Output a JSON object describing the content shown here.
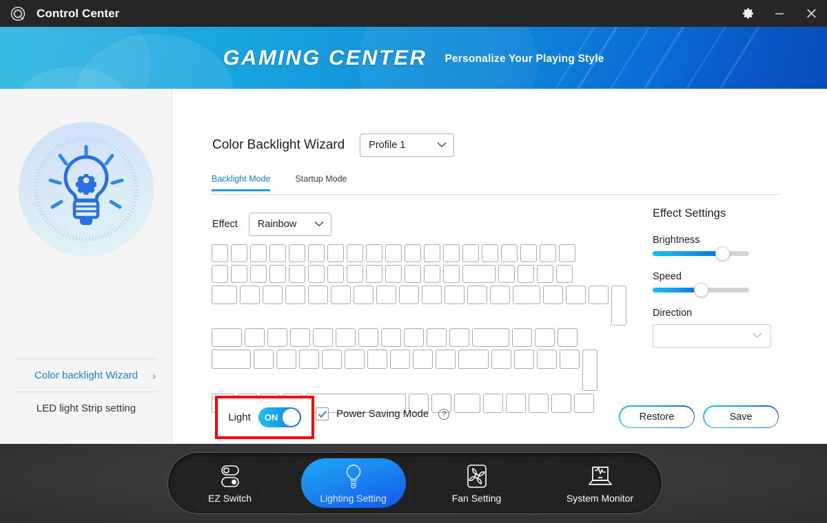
{
  "window": {
    "title": "Control Center",
    "logo_icon": "control-center-logo",
    "controls": [
      {
        "name": "settings-button",
        "icon": "gear-icon"
      },
      {
        "name": "minimize-button",
        "icon": "minimize-icon"
      },
      {
        "name": "close-button",
        "icon": "close-icon"
      }
    ]
  },
  "banner": {
    "brand": "GAMING CENTER",
    "tagline": "Personalize Your Playing Style"
  },
  "sidebar": {
    "hero_icon": "lightbulb-gear-icon",
    "items": [
      {
        "label": "Color backlight Wizard",
        "active": true,
        "chevron": "›"
      },
      {
        "label": "LED light Strip setting",
        "active": false
      }
    ]
  },
  "main": {
    "page_title": "Color Backlight Wizard",
    "profile_select": {
      "value": "Profile 1",
      "chevron_icon": "chevron-down-icon"
    },
    "tabs": [
      {
        "label": "Backlight Mode",
        "active": true
      },
      {
        "label": "Startup Mode",
        "active": false
      }
    ],
    "effect": {
      "label": "Effect",
      "value": "Rainbow",
      "chevron_icon": "chevron-down-icon"
    },
    "keyboard": {
      "rows": [
        [
          24,
          24,
          24,
          24,
          24,
          24,
          24,
          24,
          24,
          24,
          24,
          24,
          24,
          24,
          24,
          24,
          24,
          24,
          24
        ],
        [
          24,
          24,
          24,
          24,
          24,
          24,
          24,
          24,
          24,
          24,
          24,
          24,
          24,
          48,
          24,
          24,
          24,
          24
        ],
        [
          37,
          29,
          29,
          29,
          29,
          29,
          29,
          29,
          29,
          29,
          29,
          29,
          29,
          40,
          29,
          29,
          29,
          22
        ],
        [
          44,
          29,
          29,
          29,
          29,
          29,
          29,
          29,
          29,
          29,
          29,
          54,
          29,
          29,
          29,
          22
        ],
        [
          57,
          29,
          29,
          29,
          29,
          29,
          29,
          29,
          29,
          29,
          44,
          29,
          29,
          29,
          29,
          22
        ],
        [
          33,
          29,
          29,
          29,
          146,
          29,
          29,
          38,
          29,
          29,
          29,
          29,
          29,
          22
        ]
      ]
    },
    "effect_settings": {
      "title": "Effect Settings",
      "brightness": {
        "label": "Brightness",
        "value": 72
      },
      "speed": {
        "label": "Speed",
        "value": 50
      },
      "direction": {
        "label": "Direction",
        "value": "",
        "chevron_icon": "chevron-down-icon"
      }
    },
    "light_toggle": {
      "label": "Light",
      "state": "ON",
      "highlighted": true
    },
    "power_saving": {
      "label": "Power Saving Mode",
      "checked": true,
      "check_icon": "checkmark-icon",
      "help_icon": "question-mark-icon",
      "help_glyph": "?"
    },
    "buttons": [
      {
        "label": "Restore",
        "name": "restore-button"
      },
      {
        "label": "Save",
        "name": "save-button"
      }
    ]
  },
  "navbar": {
    "items": [
      {
        "label": "EZ Switch",
        "icon": "toggle-switches-icon",
        "active": false
      },
      {
        "label": "Lighting Setting",
        "icon": "lightbulb-icon",
        "active": true
      },
      {
        "label": "Fan Setting",
        "icon": "fan-icon",
        "active": false
      },
      {
        "label": "System Monitor",
        "icon": "laptop-monitor-icon",
        "active": false
      }
    ]
  },
  "colors": {
    "accent_blue": "#1a7fd4",
    "accent_cyan": "#18c3f2",
    "highlight_red": "#ff0000",
    "titlebar": "#262626",
    "sidebar_bg": "#f5f5f5"
  }
}
